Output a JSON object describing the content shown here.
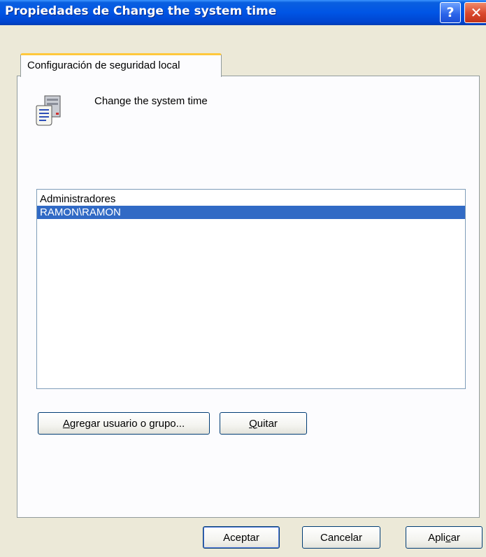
{
  "window": {
    "title": "Propiedades de Change the system time",
    "help_label": "?",
    "close_label": "✕"
  },
  "tab": {
    "label": "Configuración de seguridad local"
  },
  "policy": {
    "name": "Change the system time",
    "icon": "policy-document-icon"
  },
  "principals": {
    "items": [
      {
        "label": "Administradores",
        "selected": false
      },
      {
        "label": "RAMON\\RAMON",
        "selected": true
      }
    ]
  },
  "buttons": {
    "add": {
      "label": "Agregar usuario o grupo...",
      "mnemonic": "A"
    },
    "remove": {
      "label": "Quitar",
      "mnemonic": "Q"
    },
    "ok": {
      "label": "Aceptar"
    },
    "cancel": {
      "label": "Cancelar"
    },
    "apply": {
      "label": "Aplicar",
      "mnemonic": "c"
    }
  },
  "colors": {
    "titlebar": "#0055E5",
    "selection": "#316AC5",
    "dialog_bg": "#ECE9D8",
    "tab_highlight": "#FFC83C"
  }
}
